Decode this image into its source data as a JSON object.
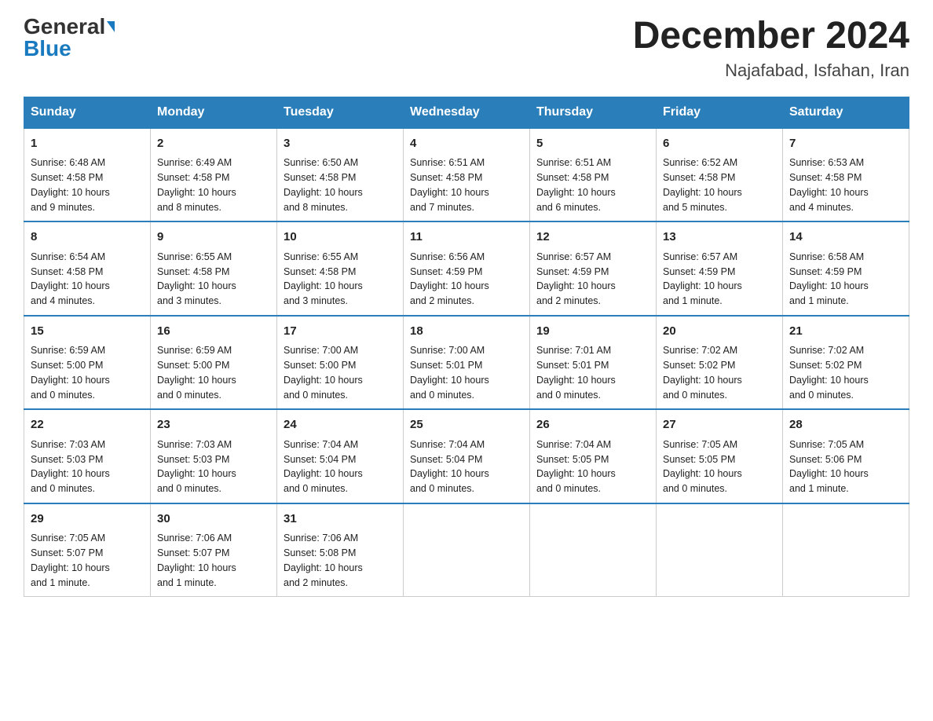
{
  "header": {
    "logo_general": "General",
    "logo_blue": "Blue",
    "month_title": "December 2024",
    "location": "Najafabad, Isfahan, Iran"
  },
  "weekdays": [
    "Sunday",
    "Monday",
    "Tuesday",
    "Wednesday",
    "Thursday",
    "Friday",
    "Saturday"
  ],
  "weeks": [
    [
      {
        "day": "1",
        "sunrise": "6:48 AM",
        "sunset": "4:58 PM",
        "daylight": "10 hours and 9 minutes."
      },
      {
        "day": "2",
        "sunrise": "6:49 AM",
        "sunset": "4:58 PM",
        "daylight": "10 hours and 8 minutes."
      },
      {
        "day": "3",
        "sunrise": "6:50 AM",
        "sunset": "4:58 PM",
        "daylight": "10 hours and 8 minutes."
      },
      {
        "day": "4",
        "sunrise": "6:51 AM",
        "sunset": "4:58 PM",
        "daylight": "10 hours and 7 minutes."
      },
      {
        "day": "5",
        "sunrise": "6:51 AM",
        "sunset": "4:58 PM",
        "daylight": "10 hours and 6 minutes."
      },
      {
        "day": "6",
        "sunrise": "6:52 AM",
        "sunset": "4:58 PM",
        "daylight": "10 hours and 5 minutes."
      },
      {
        "day": "7",
        "sunrise": "6:53 AM",
        "sunset": "4:58 PM",
        "daylight": "10 hours and 4 minutes."
      }
    ],
    [
      {
        "day": "8",
        "sunrise": "6:54 AM",
        "sunset": "4:58 PM",
        "daylight": "10 hours and 4 minutes."
      },
      {
        "day": "9",
        "sunrise": "6:55 AM",
        "sunset": "4:58 PM",
        "daylight": "10 hours and 3 minutes."
      },
      {
        "day": "10",
        "sunrise": "6:55 AM",
        "sunset": "4:58 PM",
        "daylight": "10 hours and 3 minutes."
      },
      {
        "day": "11",
        "sunrise": "6:56 AM",
        "sunset": "4:59 PM",
        "daylight": "10 hours and 2 minutes."
      },
      {
        "day": "12",
        "sunrise": "6:57 AM",
        "sunset": "4:59 PM",
        "daylight": "10 hours and 2 minutes."
      },
      {
        "day": "13",
        "sunrise": "6:57 AM",
        "sunset": "4:59 PM",
        "daylight": "10 hours and 1 minute."
      },
      {
        "day": "14",
        "sunrise": "6:58 AM",
        "sunset": "4:59 PM",
        "daylight": "10 hours and 1 minute."
      }
    ],
    [
      {
        "day": "15",
        "sunrise": "6:59 AM",
        "sunset": "5:00 PM",
        "daylight": "10 hours and 0 minutes."
      },
      {
        "day": "16",
        "sunrise": "6:59 AM",
        "sunset": "5:00 PM",
        "daylight": "10 hours and 0 minutes."
      },
      {
        "day": "17",
        "sunrise": "7:00 AM",
        "sunset": "5:00 PM",
        "daylight": "10 hours and 0 minutes."
      },
      {
        "day": "18",
        "sunrise": "7:00 AM",
        "sunset": "5:01 PM",
        "daylight": "10 hours and 0 minutes."
      },
      {
        "day": "19",
        "sunrise": "7:01 AM",
        "sunset": "5:01 PM",
        "daylight": "10 hours and 0 minutes."
      },
      {
        "day": "20",
        "sunrise": "7:02 AM",
        "sunset": "5:02 PM",
        "daylight": "10 hours and 0 minutes."
      },
      {
        "day": "21",
        "sunrise": "7:02 AM",
        "sunset": "5:02 PM",
        "daylight": "10 hours and 0 minutes."
      }
    ],
    [
      {
        "day": "22",
        "sunrise": "7:03 AM",
        "sunset": "5:03 PM",
        "daylight": "10 hours and 0 minutes."
      },
      {
        "day": "23",
        "sunrise": "7:03 AM",
        "sunset": "5:03 PM",
        "daylight": "10 hours and 0 minutes."
      },
      {
        "day": "24",
        "sunrise": "7:04 AM",
        "sunset": "5:04 PM",
        "daylight": "10 hours and 0 minutes."
      },
      {
        "day": "25",
        "sunrise": "7:04 AM",
        "sunset": "5:04 PM",
        "daylight": "10 hours and 0 minutes."
      },
      {
        "day": "26",
        "sunrise": "7:04 AM",
        "sunset": "5:05 PM",
        "daylight": "10 hours and 0 minutes."
      },
      {
        "day": "27",
        "sunrise": "7:05 AM",
        "sunset": "5:05 PM",
        "daylight": "10 hours and 0 minutes."
      },
      {
        "day": "28",
        "sunrise": "7:05 AM",
        "sunset": "5:06 PM",
        "daylight": "10 hours and 1 minute."
      }
    ],
    [
      {
        "day": "29",
        "sunrise": "7:05 AM",
        "sunset": "5:07 PM",
        "daylight": "10 hours and 1 minute."
      },
      {
        "day": "30",
        "sunrise": "7:06 AM",
        "sunset": "5:07 PM",
        "daylight": "10 hours and 1 minute."
      },
      {
        "day": "31",
        "sunrise": "7:06 AM",
        "sunset": "5:08 PM",
        "daylight": "10 hours and 2 minutes."
      },
      null,
      null,
      null,
      null
    ]
  ],
  "labels": {
    "sunrise": "Sunrise:",
    "sunset": "Sunset:",
    "daylight": "Daylight:"
  }
}
